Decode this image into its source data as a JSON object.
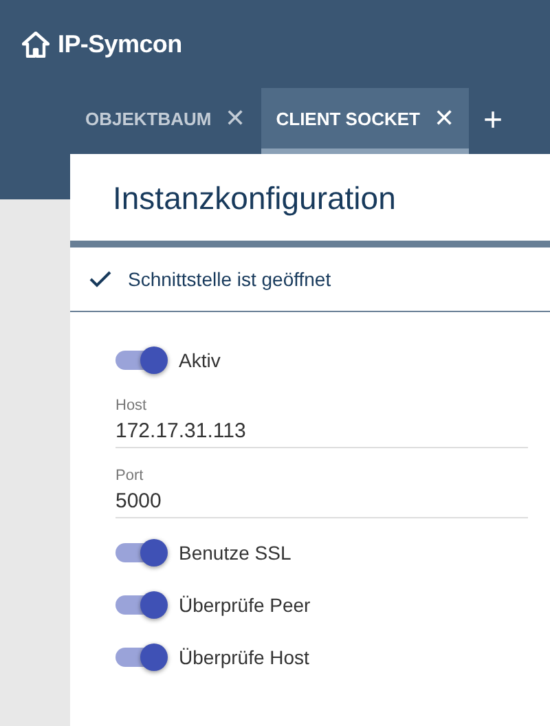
{
  "app": {
    "title": "IP-Symcon"
  },
  "tabs": [
    {
      "label": "OBJEKTBAUM",
      "selected": false,
      "close": "✕"
    },
    {
      "label": "CLIENT SOCKET",
      "selected": true,
      "close": "✕"
    }
  ],
  "add_tab": "+",
  "panel": {
    "title": "Instanzkonfiguration",
    "status": {
      "text": "Schnittstelle ist geöffnet",
      "ok": true
    },
    "elements": [
      {
        "kind": "toggle",
        "label": "Aktiv",
        "on": true
      },
      {
        "kind": "text",
        "label": "Host",
        "value": "172.17.31.113"
      },
      {
        "kind": "text",
        "label": "Port",
        "value": "5000"
      },
      {
        "kind": "toggle",
        "label": "Benutze SSL",
        "on": true
      },
      {
        "kind": "toggle",
        "label": "Überprüfe Peer",
        "on": true
      },
      {
        "kind": "toggle",
        "label": "Überprüfe Host",
        "on": true
      }
    ]
  }
}
